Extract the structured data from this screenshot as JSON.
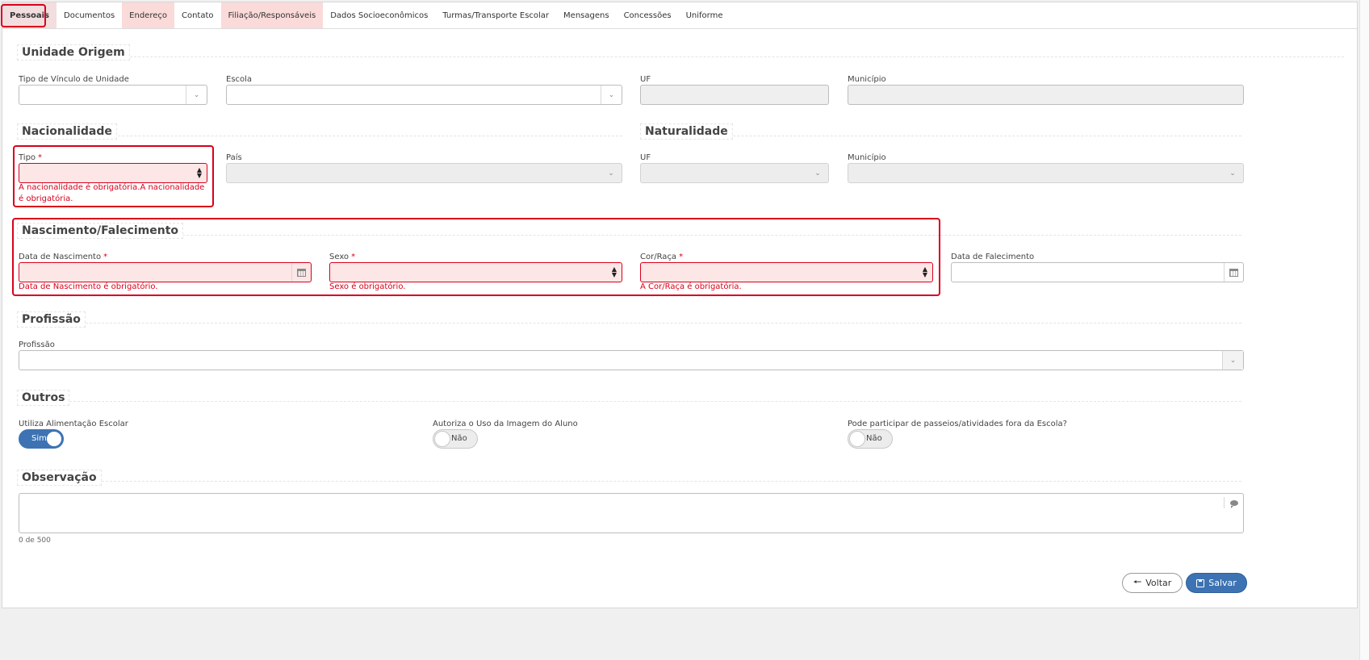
{
  "tabs": [
    {
      "label": "Pessoais",
      "state": "active"
    },
    {
      "label": "Documentos",
      "state": "normal"
    },
    {
      "label": "Endereço",
      "state": "error"
    },
    {
      "label": "Contato",
      "state": "normal"
    },
    {
      "label": "Filiação/Responsáveis",
      "state": "error"
    },
    {
      "label": "Dados Socioeconômicos",
      "state": "normal"
    },
    {
      "label": "Turmas/Transporte Escolar",
      "state": "normal"
    },
    {
      "label": "Mensagens",
      "state": "normal"
    },
    {
      "label": "Concessões",
      "state": "normal"
    },
    {
      "label": "Uniforme",
      "state": "normal"
    }
  ],
  "unidade_origem": {
    "title": "Unidade Origem",
    "tipo_vinculo_label": "Tipo de Vínculo de Unidade",
    "escola_label": "Escola",
    "uf_label": "UF",
    "municipio_label": "Município"
  },
  "nacionalidade": {
    "title": "Nacionalidade",
    "tipo_label": "Tipo",
    "tipo_error": "A nacionalidade é obrigatória.A nacionalidade é obrigatória.",
    "pais_label": "País"
  },
  "naturalidade": {
    "title": "Naturalidade",
    "uf_label": "UF",
    "municipio_label": "Município"
  },
  "nascimento": {
    "title": "Nascimento/Falecimento",
    "data_nasc_label": "Data de Nascimento",
    "data_nasc_error": "Data de Nascimento é obrigatório.",
    "sexo_label": "Sexo",
    "sexo_error": "Sexo é obrigatório.",
    "cor_label": "Cor/Raça",
    "cor_error": "A Cor/Raça é obrigatória.",
    "data_falec_label": "Data de Falecimento"
  },
  "required_mark": "*",
  "profissao": {
    "title": "Profissão",
    "label": "Profissão"
  },
  "outros": {
    "title": "Outros",
    "alimentacao_label": "Utiliza Alimentação Escolar",
    "alimentacao_value": "Sim",
    "imagem_label": "Autoriza o Uso da Imagem do Aluno",
    "imagem_value": "Não",
    "passeios_label": "Pode participar de passeios/atividades fora da Escola?",
    "passeios_value": "Não"
  },
  "observacao": {
    "title": "Observação",
    "counter": "0 de 500"
  },
  "actions": {
    "back_label": "Voltar",
    "save_label": "Salvar"
  },
  "colors": {
    "error": "#d9001b",
    "primary": "#3d73b3"
  }
}
